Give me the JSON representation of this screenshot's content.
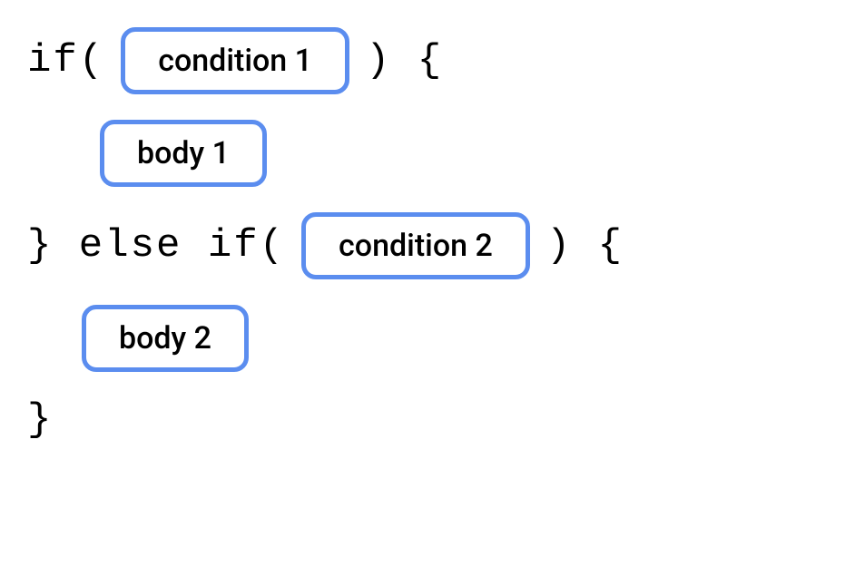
{
  "code": {
    "keyword_if": "if(",
    "keyword_close_open": ") {",
    "keyword_else_if": "} else if(",
    "keyword_close": "}",
    "condition1": "condition 1",
    "condition2": "condition 2",
    "body1": "body 1",
    "body2": "body 2"
  },
  "colors": {
    "box_border": "#5b8def",
    "text": "#000000",
    "background": "#ffffff"
  }
}
